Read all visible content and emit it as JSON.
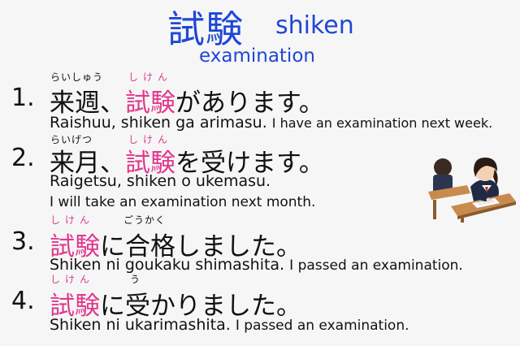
{
  "header": {
    "kanji": "試験",
    "romaji": "shiken",
    "english": "examination"
  },
  "items": [
    {
      "number": "1.",
      "furigana_a": "らいしゅう",
      "furigana_b": "しけん",
      "kanji_a": "来週、",
      "kanji_b": "試験",
      "rest": "があります。",
      "romaji": "Raishuu, shiken ga arimasu.",
      "english": "I have an examination next week."
    },
    {
      "number": "2.",
      "furigana_a": "らいげつ",
      "furigana_b": "しけん",
      "kanji_a": "来月、",
      "kanji_b": "試験",
      "rest": "を受けます。",
      "romaji": "Raigetsu, shiken o ukemasu.",
      "english": "I will take an examination next month."
    },
    {
      "number": "3.",
      "furigana_a": "しけん",
      "furigana_b": "ごうかく",
      "kanji_a": "試験",
      "kanji_b": "に合格しました。",
      "romaji": "Shiken ni goukaku shimashita.",
      "english": "I passed an examination."
    },
    {
      "number": "4.",
      "furigana_a": "しけん",
      "furigana_b": "う",
      "kanji_a": "試験",
      "kanji_b": "に受かりました。",
      "romaji": "Shiken ni ukarimashita.",
      "english": "I passed an examination."
    }
  ],
  "illustration": {
    "icon": "students-taking-exam-illustration"
  },
  "colors": {
    "title_blue": "#1f47d6",
    "highlight_pink": "#e0398e",
    "text": "#111111",
    "background": "#f6f6f6"
  }
}
